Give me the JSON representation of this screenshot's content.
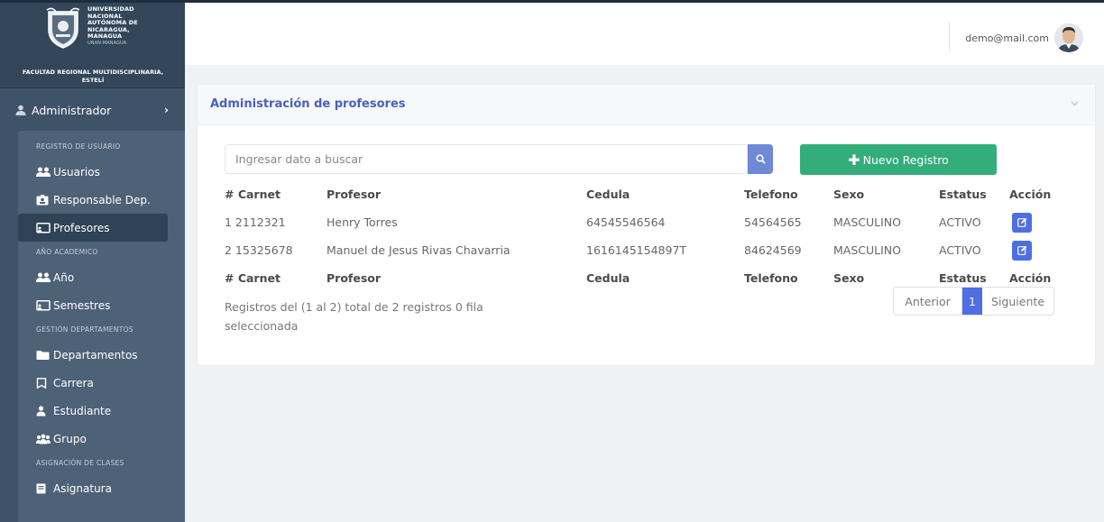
{
  "brand": {
    "university_lines": [
      "UNIVERSIDAD",
      "NACIONAL",
      "AUTÓNOMA DE",
      "NICARAGUA,",
      "MANAGUA"
    ],
    "university_sub": "UNAN-MANAGUA",
    "faculty_line1": "FACULTAD REGIONAL MULTIDISCIPLINARIA,",
    "faculty_line2": "ESTELÍ"
  },
  "sidebar": {
    "role_label": "Administrador",
    "sections": {
      "registro": "REGISTRO DE USUARIO",
      "anio": "AÑO ACADEMICO",
      "gestion": "GESTIÓN DEPARTAMENTOS",
      "asignacion": "ASIGNACIÓN DE CLASES"
    },
    "items": {
      "usuarios": "Usuarios",
      "responsable": "Responsable Dep.",
      "profesores": "Profesores",
      "anio": "Año",
      "semestres": "Semestres",
      "departamentos": "Departamentos",
      "carrera": "Carrera",
      "estudiante": "Estudiante",
      "grupo": "Grupo",
      "asignatura": "Asignatura"
    },
    "active_item": "Profesores"
  },
  "topbar": {
    "email": "demo@mail.com"
  },
  "card": {
    "title": "Administración de profesores",
    "search_placeholder": "Ingresar dato a buscar",
    "new_button_label": "Nuevo Registro"
  },
  "table": {
    "headers": [
      "# Carnet",
      "Profesor",
      "Cedula",
      "Telefono",
      "Sexo",
      "Estatus",
      "Acción"
    ],
    "rows": [
      [
        "1 2112321",
        "Henry Torres",
        "64545546564",
        "54564565",
        "MASCULINO",
        "ACTIVO"
      ],
      [
        "2 15325678",
        "Manuel de Jesus Rivas Chavarria",
        "1616145154897T",
        "84624569",
        "MASCULINO",
        "ACTIVO"
      ]
    ]
  },
  "footer": {
    "info_text": "Registros del (1 al 2) total de 2 registros   0 fila seleccionada",
    "prev_label": "Anterior",
    "current_page": "1",
    "next_label": "Siguiente"
  },
  "colors": {
    "sidebar_bg": "#3f5368",
    "menu_bg": "#4d6177",
    "active_item_bg": "#2f4256",
    "title_blue": "#4a61b9",
    "search_button": "#6f88d8",
    "new_button_green": "#33ad7a",
    "action_blue": "#4e6fe3"
  }
}
